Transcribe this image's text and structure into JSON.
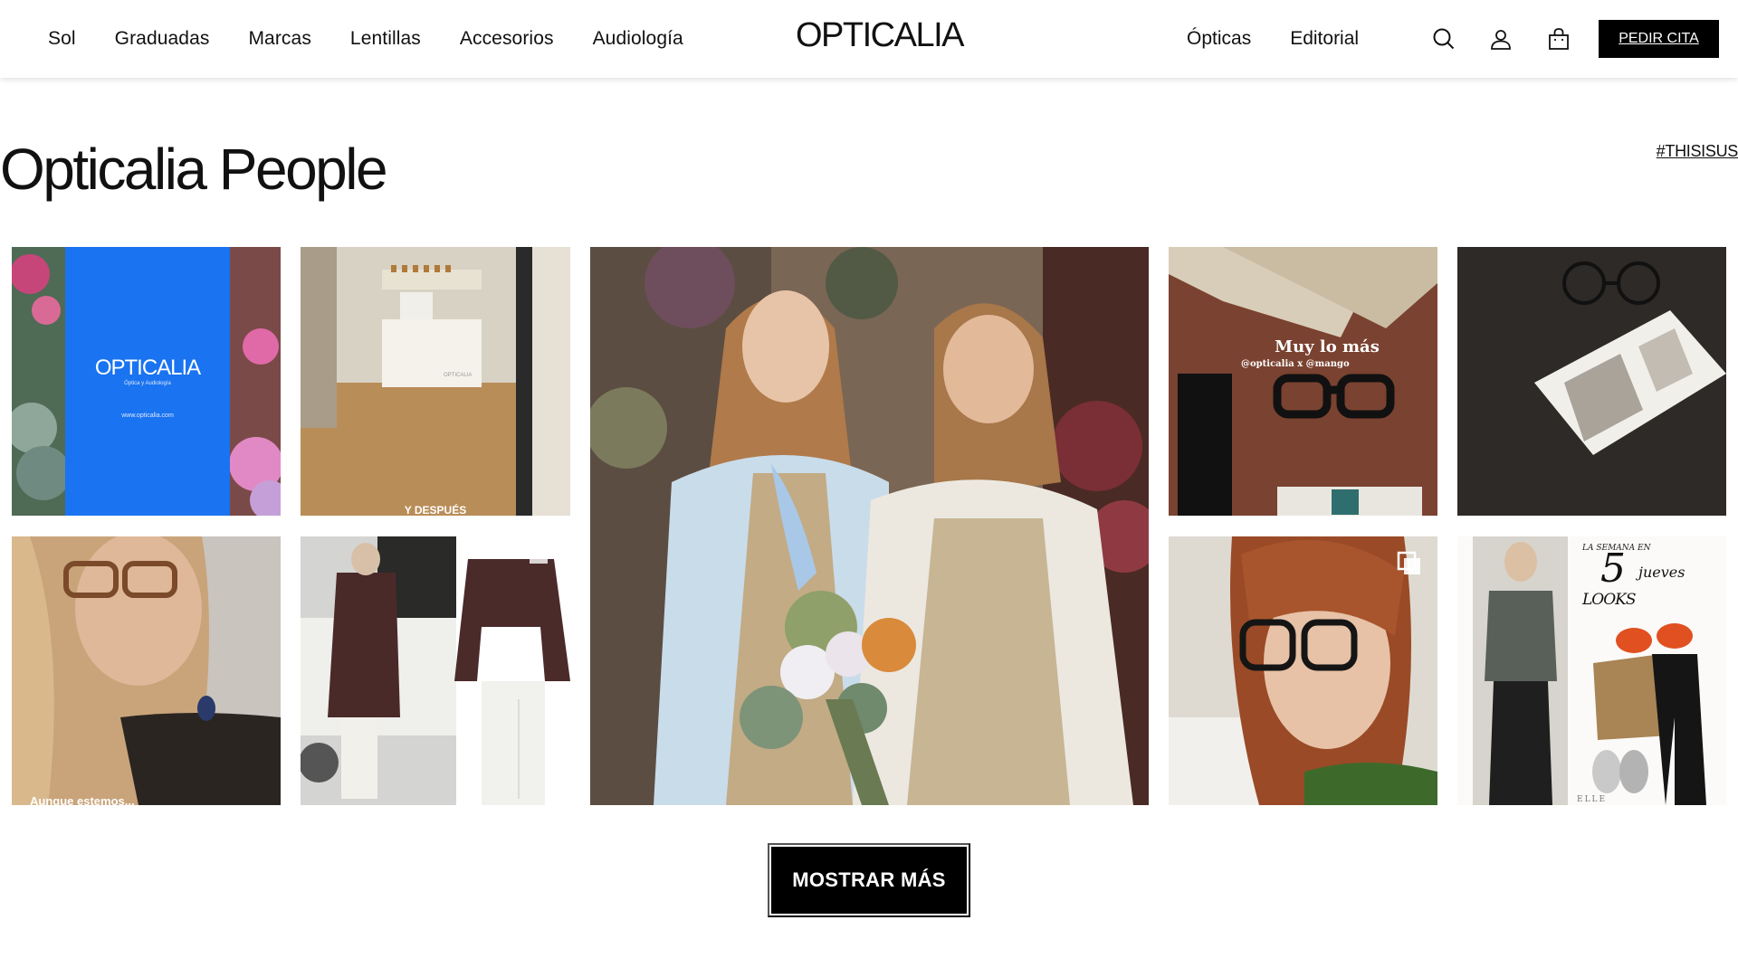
{
  "header": {
    "nav_left": [
      "Sol",
      "Graduadas",
      "Marcas",
      "Lentillas",
      "Accesorios",
      "Audiología"
    ],
    "logo": "OPTICALIA",
    "nav_right": [
      "Ópticas",
      "Editorial"
    ],
    "icons": [
      "search-icon",
      "user-icon",
      "bag-icon"
    ],
    "cta_label": "PEDIR CITA"
  },
  "section": {
    "title": "Opticalia People",
    "hashtag": "#THISISUS"
  },
  "tiles": {
    "t1": {
      "logo": "OPTICALIA",
      "tagline": "Óptica y Audiología",
      "url": "www.opticalia.com"
    },
    "t2": {
      "caption": "Y DESPUÉS",
      "store_sign": "OPTICALIA"
    },
    "t4": {
      "headline": "Muy lo más",
      "sub": "@opticalia x @mango"
    },
    "t6": {
      "caption": "Aunque estemos..."
    },
    "t9": {
      "kicker": "LA SEMANA EN",
      "number": "5",
      "word": "jueves",
      "looks": "LOOKS",
      "footer": "ELLE"
    }
  },
  "actions": {
    "show_more": "MOSTRAR MÁS"
  },
  "colors": {
    "brand_blue": "#1a73f0",
    "black": "#000000"
  }
}
